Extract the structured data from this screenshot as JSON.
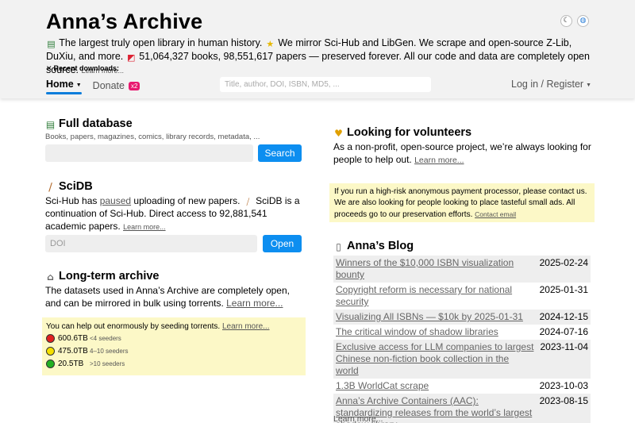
{
  "header": {
    "title": "Anna’s Archive",
    "tagline_a": " The largest truly open library in human history. ",
    "tagline_b": " We mirror Sci-Hub and LibGen. We scrape and open-source Z-Lib, DuXiu, and more. ",
    "tagline_c": " 51,064,327 books, 98,551,617 papers — preserved forever. All our code and data are completely open source. ",
    "learn_more": "Learn more...",
    "recent_downloads": "Recent downloads:",
    "icons": {
      "dark_mode": "moon-icon",
      "language": "globe-icon"
    }
  },
  "nav": {
    "home": "Home",
    "donate": "Donate",
    "donate_badge": "x2",
    "search_placeholder": "Title, author, DOI, ISBN, MD5, ...",
    "login": "Log in / Register"
  },
  "full_database": {
    "title": "Full database",
    "subtitle": "Books, papers, magazines, comics, library records, metadata, ...",
    "search_button": "Search"
  },
  "scidb": {
    "title": "SciDB",
    "text_a": "Sci-Hub has ",
    "paused": "paused",
    "text_b": " uploading of new papers. ",
    "text_c": " SciDB is a continuation of Sci-Hub. Direct access to 92,881,541 academic papers. ",
    "learn_more": "Learn more...",
    "doi_placeholder": "DOI",
    "open_button": "Open"
  },
  "long_term": {
    "title": "Long-term archive",
    "text": "The datasets used in Anna’s Archive are completely open, and can be mirrored in bulk using torrents. ",
    "learn_more": "Learn more..."
  },
  "seeding": {
    "intro": "You can help out enormously by seeding torrents. ",
    "learn_more": "Learn more...",
    "rows": [
      {
        "size": "600.6TB",
        "label": "<4 seeders",
        "color": "#e02020"
      },
      {
        "size": "475.0TB",
        "label": "4–10 seeders",
        "color": "#f5e000"
      },
      {
        "size": "20.5TB",
        "label": ">10 seeders",
        "color": "#22b022"
      }
    ]
  },
  "volunteers": {
    "title": "Looking for volunteers",
    "text": "As a non-profit, open-source project, we’re always looking for people to help out. ",
    "learn_more": "Learn more..."
  },
  "notice": {
    "text": "If you run a high-risk anonymous payment processor, please contact us. We are also looking for people looking to place tasteful small ads. All proceeds go to our preservation efforts. ",
    "contact": "Contact email"
  },
  "blog": {
    "title": "Anna’s Blog",
    "posts": [
      {
        "title": "Winners of the $10,000 ISBN visualization bounty",
        "date": "2025-02-24"
      },
      {
        "title": "Copyright reform is necessary for national security",
        "date": "2025-01-31"
      },
      {
        "title": "Visualizing All ISBNs — $10k by 2025-01-31",
        "date": "2024-12-15"
      },
      {
        "title": "The critical window of shadow libraries",
        "date": "2024-07-16"
      },
      {
        "title": "Exclusive access for LLM companies to largest Chinese non-fiction book collection in the world",
        "date": "2023-11-04"
      },
      {
        "title": "1.3B WorldCat scrape",
        "date": "2023-10-03"
      },
      {
        "title": "Anna’s Archive Containers (AAC): standardizing releases from the world’s largest shadow library",
        "date": "2023-08-15"
      }
    ],
    "more": "Learn more..."
  }
}
